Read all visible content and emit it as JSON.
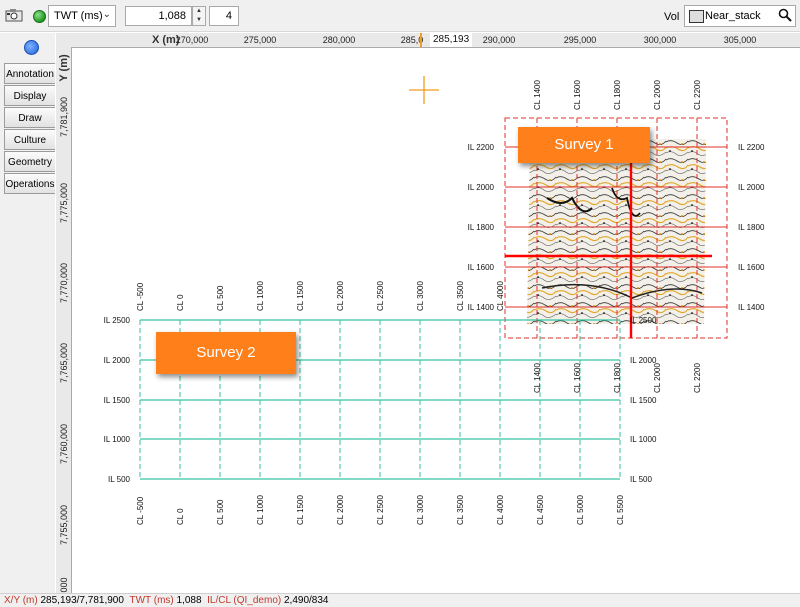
{
  "toolbar": {
    "domain": "TWT (ms)",
    "time_value": "1,088",
    "step_value": "4",
    "vol_label": "Vol",
    "volume": "Near_stack"
  },
  "side_tabs": [
    "Annotation",
    "Display",
    "Draw",
    "Culture",
    "Geometry",
    "Operations"
  ],
  "axes": {
    "x_label": "X (m)",
    "y_label": "Y (m)",
    "x_ticks": [
      "270,000",
      "275,000",
      "280,000",
      "285,0",
      "290,000",
      "295,000",
      "300,000",
      "305,000"
    ],
    "y_ticks": [
      "7,781,900",
      "7,775,000",
      "7,770,000",
      "7,765,000",
      "7,760,000",
      "7,755,000",
      "000"
    ],
    "cursor_x": "285,193"
  },
  "surveys": {
    "survey1": {
      "label": "Survey 1",
      "crosslines_top": [
        "CL 1400",
        "CL 1600",
        "CL 1800",
        "CL 2000",
        "CL 2200"
      ],
      "crosslines_bottom": [
        "CL 1400",
        "CL 1600",
        "CL 1800",
        "CL 2000",
        "CL 2200"
      ],
      "inlines_left": [
        "IL 2200",
        "IL 2000",
        "IL 1800",
        "IL 1600",
        "IL 1400"
      ],
      "inlines_right": [
        "IL 2200",
        "IL 2000",
        "IL 1800",
        "IL 1600",
        "IL 1400"
      ],
      "grid_color": "#e0302a",
      "cursor_color": "#ff0000"
    },
    "survey2": {
      "label": "Survey 2",
      "crosslines_top": [
        "CL -500",
        "CL 0",
        "CL 500",
        "CL 1000",
        "CL 1500",
        "CL 2000",
        "CL 2500",
        "CL 3000",
        "CL 3500",
        "CL 4000"
      ],
      "crosslines_bottom": [
        "CL -500",
        "CL 0",
        "CL 500",
        "CL 1000",
        "CL 1500",
        "CL 2000",
        "CL 2500",
        "CL 3000",
        "CL 3500",
        "CL 4000",
        "CL 4500",
        "CL 5000",
        "CL 5500"
      ],
      "inlines_left": [
        "IL 2500",
        "IL 2000",
        "IL 1500",
        "IL 1000",
        "IL 500"
      ],
      "inlines_right": [
        "IL 2500",
        "IL 2000",
        "IL 1500",
        "IL 1000",
        "IL 500"
      ],
      "grid_color": "#37c2a2"
    }
  },
  "status": {
    "xy_key": "X/Y (m)",
    "xy_val": "285,193/7,781,900",
    "twt_key": "TWT (ms)",
    "twt_val": "1,088",
    "ilcl_key": "IL/CL (QI_demo)",
    "ilcl_val": "2,490/834"
  }
}
